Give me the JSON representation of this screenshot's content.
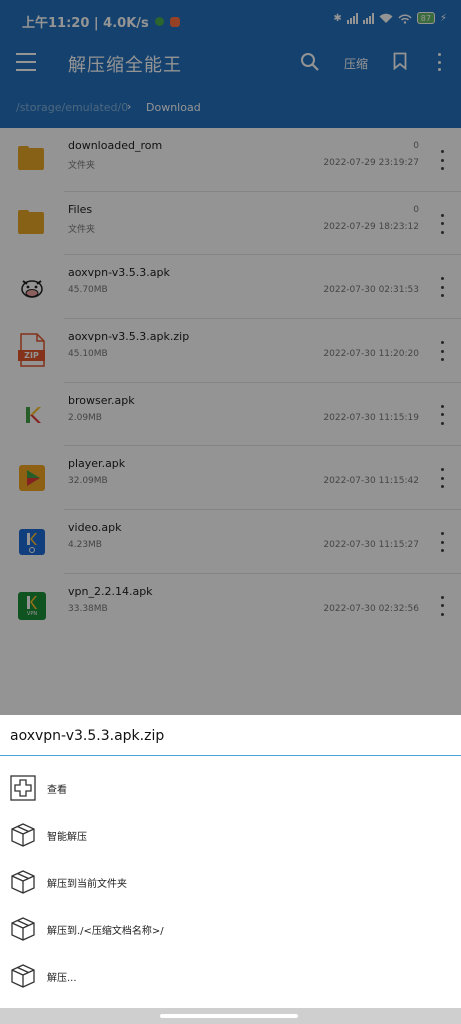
{
  "status_bar": {
    "time_speed": "上午11:20 | 4.0K/s",
    "battery": "87"
  },
  "app_bar": {
    "title": "解压缩全能王",
    "compress_label": "压缩",
    "icons": [
      "menu-icon",
      "search-icon",
      "bookmark-icon",
      "more-vert-icon"
    ]
  },
  "path": {
    "root": "/storage/emulated/0",
    "separator": "›",
    "current": "Download"
  },
  "files": [
    {
      "name": "downloaded_rom",
      "sub": "文件夹",
      "count": "0",
      "date": "2022-07-29 23:19:27",
      "icon": "folder-icon"
    },
    {
      "name": "Files",
      "sub": "文件夹",
      "count": "0",
      "date": "2022-07-29 18:23:12",
      "icon": "folder-icon"
    },
    {
      "name": "aoxvpn-v3.5.3.apk",
      "sub": "45.70MB",
      "count": "",
      "date": "2022-07-30 02:31:53",
      "icon": "cow-app-icon"
    },
    {
      "name": "aoxvpn-v3.5.3.apk.zip",
      "sub": "45.10MB",
      "count": "",
      "date": "2022-07-30 11:20:20",
      "icon": "zip-file-icon",
      "icon_text": "ZIP"
    },
    {
      "name": "browser.apk",
      "sub": "2.09MB",
      "count": "",
      "date": "2022-07-30 11:15:19",
      "icon": "k-app-icon"
    },
    {
      "name": "player.apk",
      "sub": "32.09MB",
      "count": "",
      "date": "2022-07-30 11:15:42",
      "icon": "player-app-icon"
    },
    {
      "name": "video.apk",
      "sub": "4.23MB",
      "count": "",
      "date": "2022-07-30 11:15:27",
      "icon": "video-app-icon"
    },
    {
      "name": "vpn_2.2.14.apk",
      "sub": "33.38MB",
      "count": "",
      "date": "2022-07-30 02:32:56",
      "icon": "vpn-app-icon",
      "icon_text": "VPN"
    }
  ],
  "sheet": {
    "title": "aoxvpn-v3.5.3.apk.zip",
    "actions": [
      {
        "label": "查看",
        "icon": "plus-view-icon"
      },
      {
        "label": "智能解压",
        "icon": "box-icon"
      },
      {
        "label": "解压到当前文件夹",
        "icon": "box-icon"
      },
      {
        "label": "解压到./<压缩文档名称>/",
        "icon": "box-icon"
      },
      {
        "label": "解压...",
        "icon": "box-icon"
      }
    ]
  },
  "colors": {
    "primary": "#2371bd",
    "folder": "#e8a825",
    "zip": "#e3562e",
    "accent_line": "#4aa3d8"
  }
}
